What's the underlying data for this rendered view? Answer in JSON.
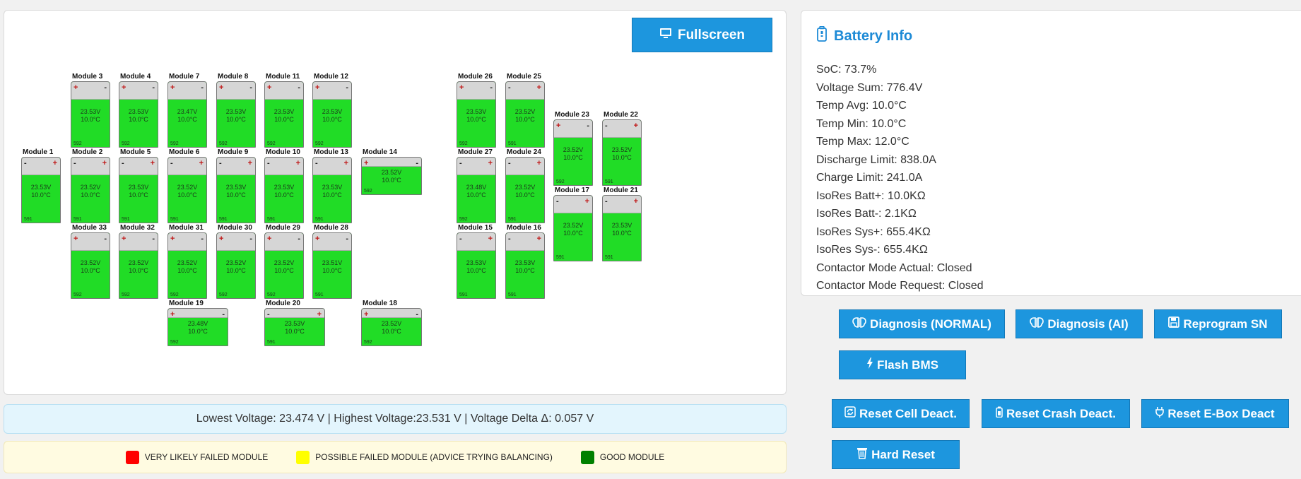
{
  "diagram": {
    "fullscreen_label": "Fullscreen",
    "modules": [
      {
        "name": "Module 1",
        "voltage": "23.53V",
        "temp": "10.0°C",
        "sn": "591",
        "pol": "minus-plus"
      },
      {
        "name": "Module 2",
        "voltage": "23.52V",
        "temp": "10.0°C",
        "sn": "591",
        "pol": "minus-plus"
      },
      {
        "name": "Module 3",
        "voltage": "23.53V",
        "temp": "10.0°C",
        "sn": "592",
        "pol": "plus-minus"
      },
      {
        "name": "Module 4",
        "voltage": "23.53V",
        "temp": "10.0°C",
        "sn": "592",
        "pol": "plus-minus"
      },
      {
        "name": "Module 5",
        "voltage": "23.53V",
        "temp": "10.0°C",
        "sn": "591",
        "pol": "minus-plus"
      },
      {
        "name": "Module 6",
        "voltage": "23.52V",
        "temp": "10.0°C",
        "sn": "591",
        "pol": "minus-plus"
      },
      {
        "name": "Module 7",
        "voltage": "23.47V",
        "temp": "10.0°C",
        "sn": "592",
        "pol": "plus-minus"
      },
      {
        "name": "Module 8",
        "voltage": "23.53V",
        "temp": "10.0°C",
        "sn": "592",
        "pol": "plus-minus"
      },
      {
        "name": "Module 9",
        "voltage": "23.53V",
        "temp": "10.0°C",
        "sn": "591",
        "pol": "minus-plus"
      },
      {
        "name": "Module 10",
        "voltage": "23.53V",
        "temp": "10.0°C",
        "sn": "591",
        "pol": "minus-plus"
      },
      {
        "name": "Module 11",
        "voltage": "23.53V",
        "temp": "10.0°C",
        "sn": "592",
        "pol": "plus-minus"
      },
      {
        "name": "Module 12",
        "voltage": "23.53V",
        "temp": "10.0°C",
        "sn": "592",
        "pol": "plus-minus"
      },
      {
        "name": "Module 13",
        "voltage": "23.53V",
        "temp": "10.0°C",
        "sn": "591",
        "pol": "minus-plus"
      },
      {
        "name": "Module 14",
        "voltage": "23.52V",
        "temp": "10.0°C",
        "sn": "592",
        "pol": "plus-minus"
      },
      {
        "name": "Module 15",
        "voltage": "23.53V",
        "temp": "10.0°C",
        "sn": "591",
        "pol": "minus-plus"
      },
      {
        "name": "Module 16",
        "voltage": "23.53V",
        "temp": "10.0°C",
        "sn": "591",
        "pol": "minus-plus"
      },
      {
        "name": "Module 17",
        "voltage": "23.52V",
        "temp": "10.0°C",
        "sn": "591",
        "pol": "minus-plus"
      },
      {
        "name": "Module 18",
        "voltage": "23.52V",
        "temp": "10.0°C",
        "sn": "592",
        "pol": "plus-minus"
      },
      {
        "name": "Module 19",
        "voltage": "23.48V",
        "temp": "10.0°C",
        "sn": "592",
        "pol": "plus-minus"
      },
      {
        "name": "Module 20",
        "voltage": "23.53V",
        "temp": "10.0°C",
        "sn": "591",
        "pol": "minus-plus"
      },
      {
        "name": "Module 21",
        "voltage": "23.53V",
        "temp": "10.0°C",
        "sn": "591",
        "pol": "minus-plus"
      },
      {
        "name": "Module 22",
        "voltage": "23.52V",
        "temp": "10.0°C",
        "sn": "591",
        "pol": "minus-plus"
      },
      {
        "name": "Module 23",
        "voltage": "23.52V",
        "temp": "10.0°C",
        "sn": "592",
        "pol": "plus-minus"
      },
      {
        "name": "Module 24",
        "voltage": "23.52V",
        "temp": "10.0°C",
        "sn": "591",
        "pol": "minus-plus"
      },
      {
        "name": "Module 25",
        "voltage": "23.52V",
        "temp": "10.0°C",
        "sn": "591",
        "pol": "minus-plus"
      },
      {
        "name": "Module 26",
        "voltage": "23.53V",
        "temp": "10.0°C",
        "sn": "592",
        "pol": "plus-minus"
      },
      {
        "name": "Module 27",
        "voltage": "23.48V",
        "temp": "10.0°C",
        "sn": "592",
        "pol": "minus-plus"
      },
      {
        "name": "Module 28",
        "voltage": "23.51V",
        "temp": "10.0°C",
        "sn": "591",
        "pol": "plus-minus"
      },
      {
        "name": "Module 29",
        "voltage": "23.52V",
        "temp": "10.0°C",
        "sn": "592",
        "pol": "plus-minus"
      },
      {
        "name": "Module 30",
        "voltage": "23.52V",
        "temp": "10.0°C",
        "sn": "592",
        "pol": "plus-minus"
      },
      {
        "name": "Module 31",
        "voltage": "23.52V",
        "temp": "10.0°C",
        "sn": "592",
        "pol": "plus-minus"
      },
      {
        "name": "Module 32",
        "voltage": "23.52V",
        "temp": "10.0°C",
        "sn": "592",
        "pol": "plus-minus"
      },
      {
        "name": "Module 33",
        "voltage": "23.52V",
        "temp": "10.0°C",
        "sn": "592",
        "pol": "plus-minus"
      }
    ]
  },
  "stats_text": "Lowest Voltage: 23.474 V | Highest Voltage:23.531 V | Voltage Delta Δ: 0.057 V",
  "legend": [
    {
      "label": "VERY LIKELY FAILED MODULE",
      "color": "#ff0000"
    },
    {
      "label": "POSSIBLE FAILED MODULE (ADVICE TRYING BALANCING)",
      "color": "#ffff00"
    },
    {
      "label": "GOOD MODULE",
      "color": "#008000"
    }
  ],
  "battery_info": {
    "title": "Battery Info",
    "lines": [
      "SoC: 73.7%",
      "Voltage Sum: 776.4V",
      "Temp Avg: 10.0°C",
      "Temp Min: 10.0°C",
      "Temp Max: 12.0°C",
      "Discharge Limit: 838.0A",
      "Charge Limit: 241.0A",
      "IsoRes Batt+: 10.0KΩ",
      "IsoRes Batt-: 2.1KΩ",
      "IsoRes Sys+: 655.4KΩ",
      "IsoRes Sys-: 655.4KΩ",
      "Contactor Mode Actual: Closed",
      "Contactor Mode Request: Closed"
    ]
  },
  "actions": {
    "diag_normal": "Diagnosis (NORMAL)",
    "diag_ai": "Diagnosis (AI)",
    "reprogram_sn": "Reprogram SN",
    "flash_bms": "Flash BMS",
    "reset_cell": "Reset Cell Deact.",
    "reset_crash": "Reset Crash Deact.",
    "reset_ebox": "Reset E-Box Deact",
    "hard_reset": "Hard Reset"
  },
  "colors": {
    "accent": "#1d96de",
    "module_good": "#21dc26",
    "module_cap": "#d6d6d6"
  }
}
